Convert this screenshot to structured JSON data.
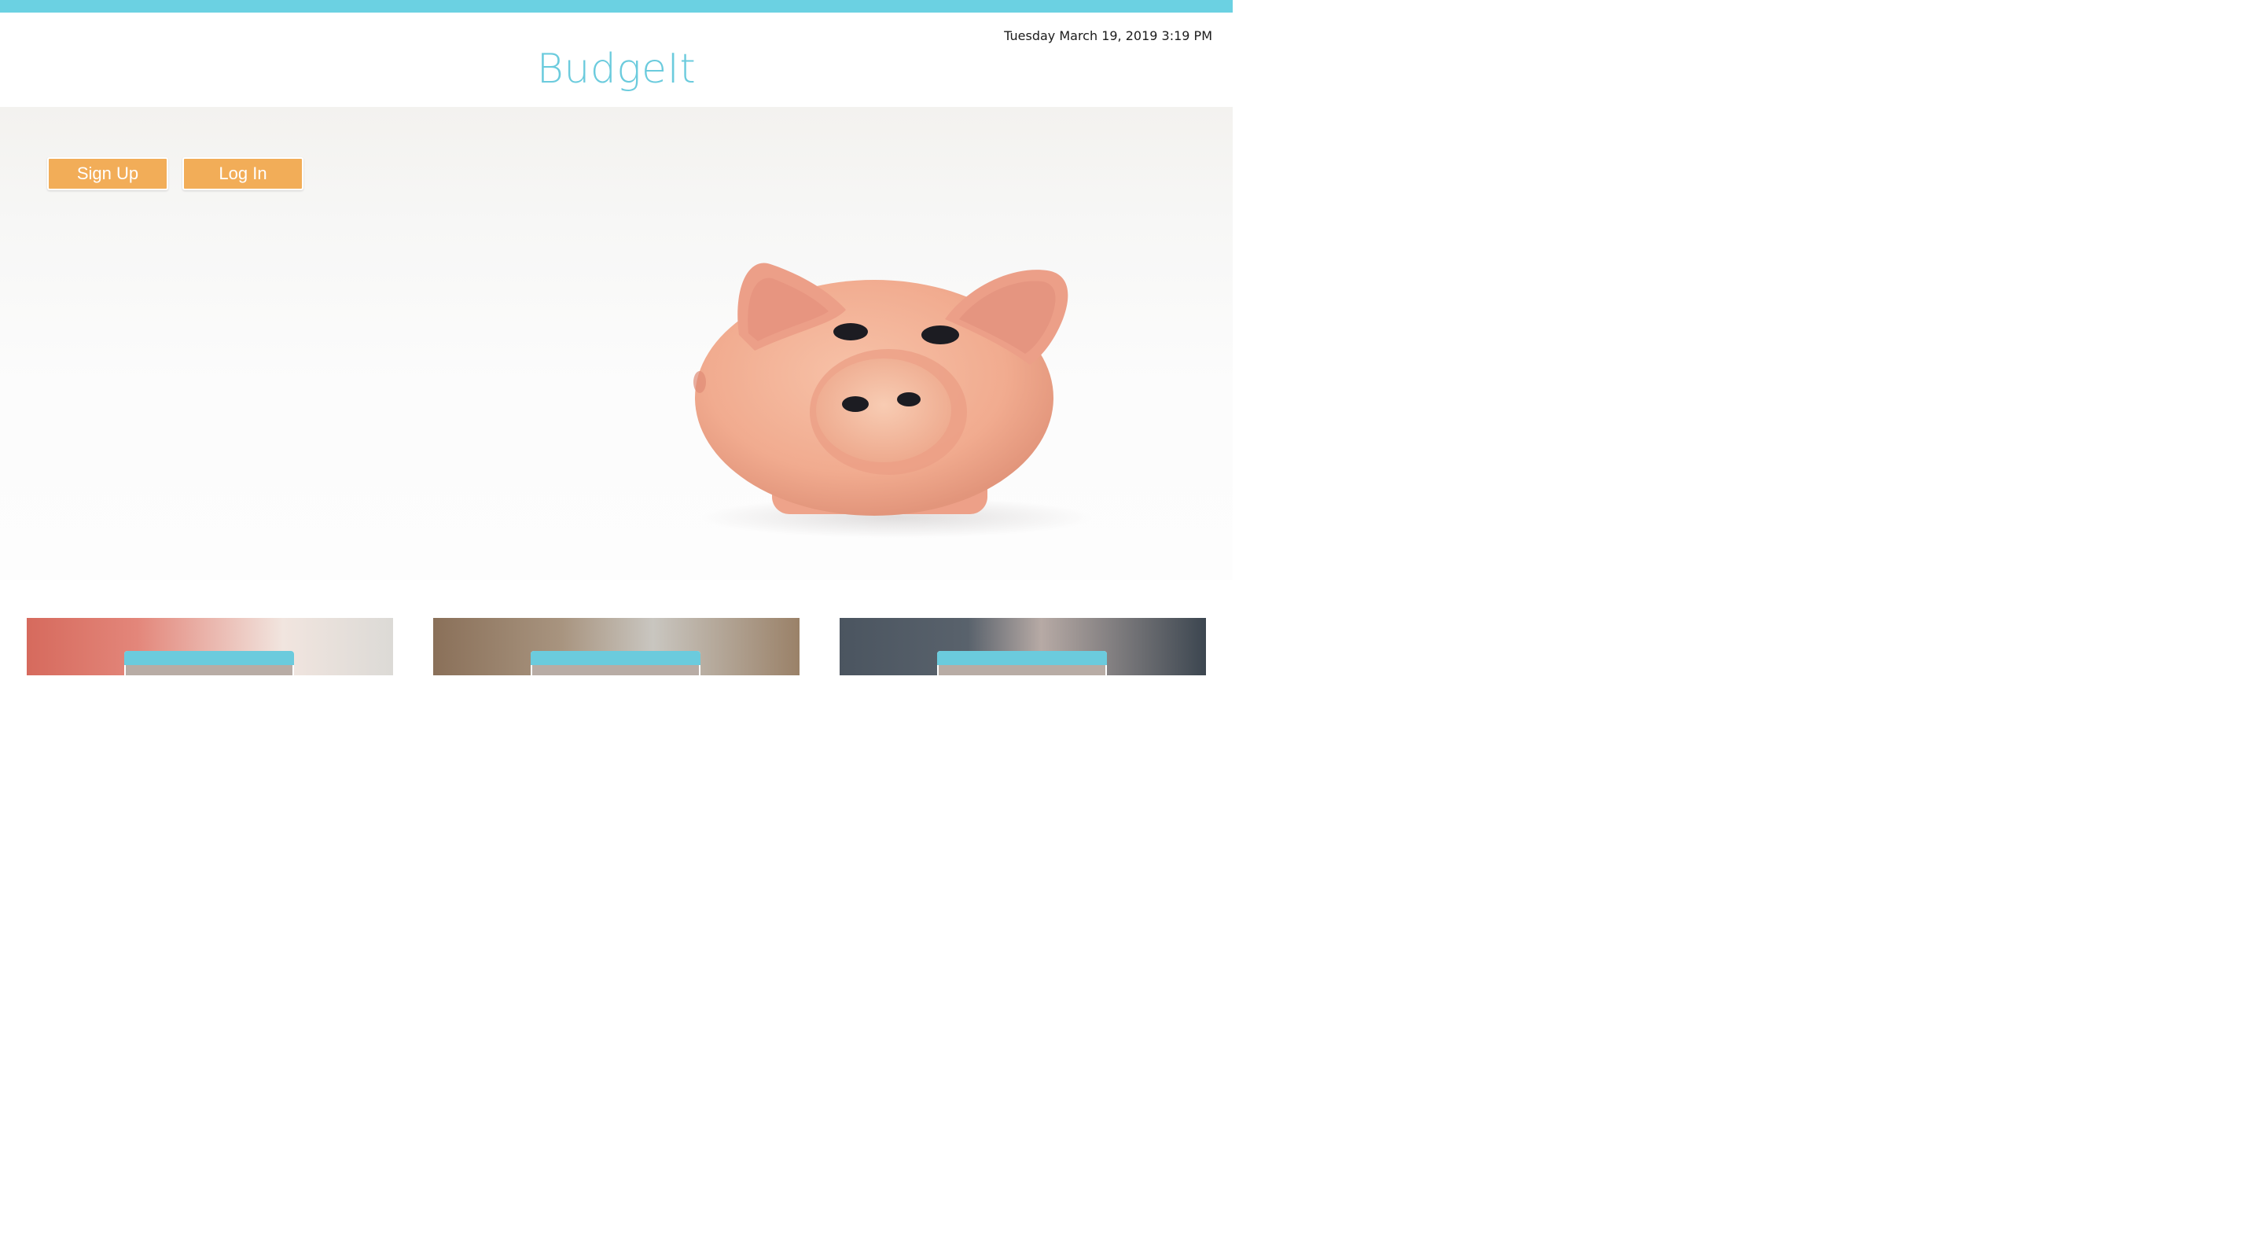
{
  "header": {
    "datetime": "Tuesday March 19, 2019 3:19 PM",
    "brand": "BudgeIt"
  },
  "hero": {
    "image": "piggy-bank-photo",
    "buttons": {
      "signup": "Sign Up",
      "login": "Log In"
    }
  },
  "colors": {
    "accent": "#6bcbdd",
    "button": "#f2ad58",
    "topbar": "#6bd1e2"
  },
  "cards": [
    {
      "image": "photo-card-1"
    },
    {
      "image": "photo-card-2"
    },
    {
      "image": "photo-card-3"
    }
  ]
}
